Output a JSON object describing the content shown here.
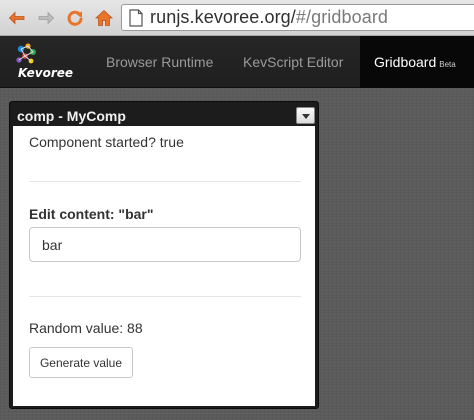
{
  "browser": {
    "url_host": "runjs.kevoree.org/",
    "url_path": "#/gridboard",
    "icons": [
      "back-arrow-icon",
      "forward-arrow-icon",
      "reload-icon",
      "home-icon",
      "page-icon"
    ]
  },
  "navbar": {
    "logo_text": "Kevoree",
    "links": [
      {
        "label": "Browser Runtime",
        "active": false
      },
      {
        "label": "KevScript Editor",
        "active": false
      },
      {
        "label": "Gridboard",
        "badge": "Beta",
        "active": true
      }
    ]
  },
  "widget": {
    "title": "comp - MyComp",
    "status": "Component started? true",
    "edit_label": "Edit content: \"bar\"",
    "input_value": "bar",
    "random_label": "Random value: 88",
    "generate_label": "Generate value"
  },
  "colors": {
    "navbar_bg": "#222222",
    "active_nav_bg": "#080808",
    "board_bg": "#5b5b5b",
    "nav_arrow": "#e8742a"
  }
}
